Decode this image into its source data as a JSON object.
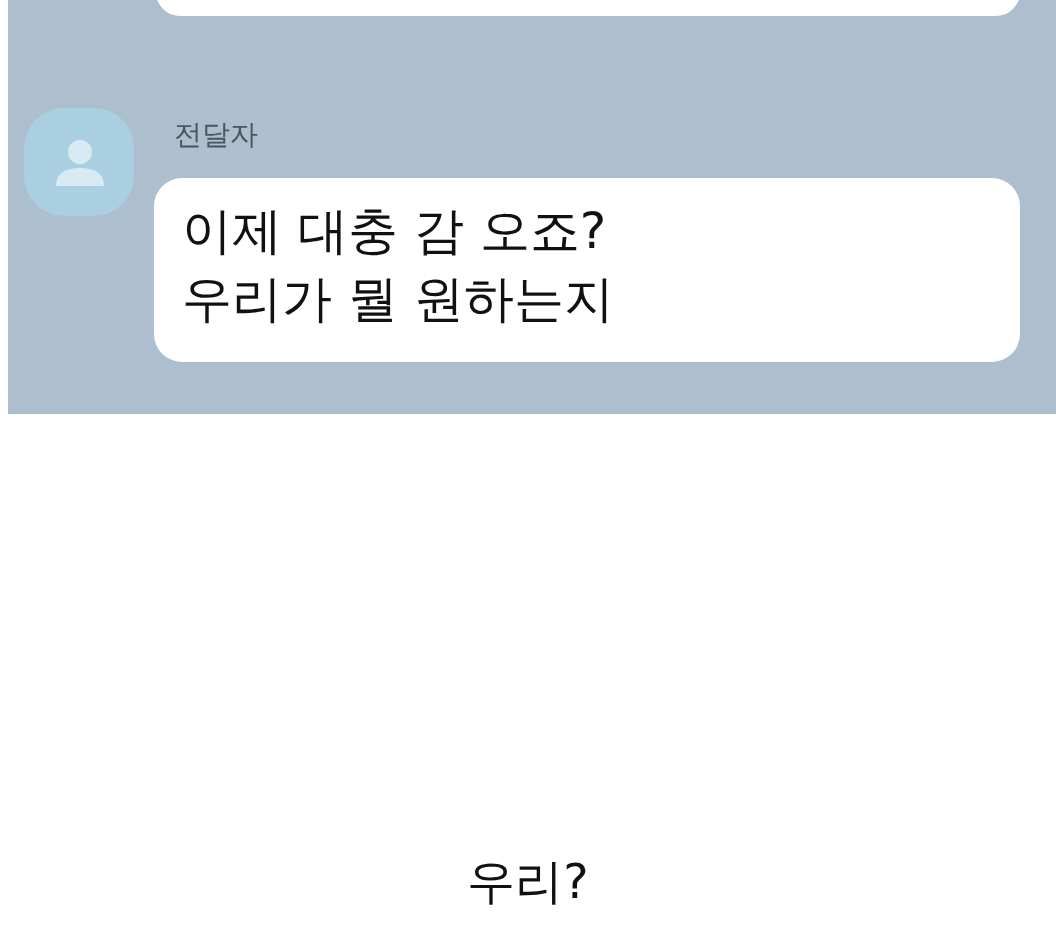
{
  "messages": [
    {
      "kind": "cut"
    },
    {
      "kind": "incoming",
      "sender": "전달자",
      "lines": [
        "이제 대충 감 오죠?",
        "우리가 뭘 원하는지"
      ]
    }
  ],
  "caption": "우리?"
}
